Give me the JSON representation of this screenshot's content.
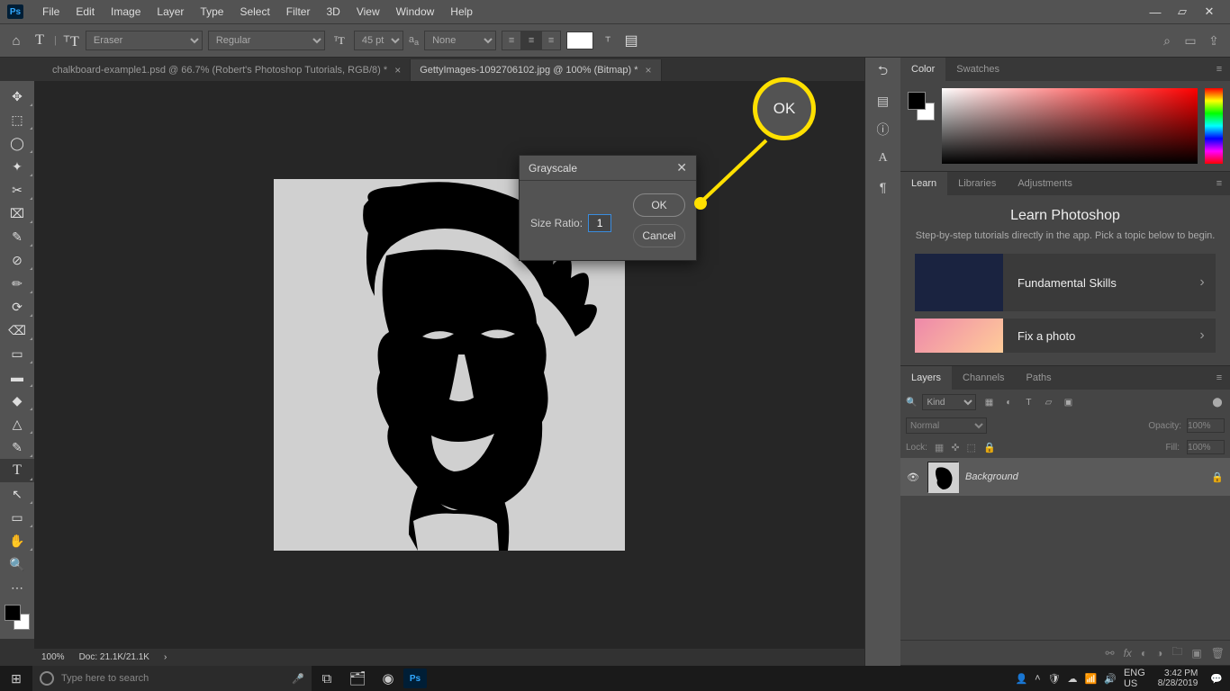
{
  "menubar": {
    "items": [
      "File",
      "Edit",
      "Image",
      "Layer",
      "Type",
      "Select",
      "Filter",
      "3D",
      "View",
      "Window",
      "Help"
    ]
  },
  "optbar": {
    "tool": "Eraser",
    "weight": "Regular",
    "size": "45 pt",
    "aa": "None"
  },
  "tabs": [
    {
      "label": "chalkboard-example1.psd @ 66.7% (Robert's Photoshop Tutorials, RGB/8) *",
      "active": false
    },
    {
      "label": "GettyImages-1092706102.jpg @ 100% (Bitmap) *",
      "active": true
    }
  ],
  "tools": [
    "↔",
    "⬚",
    "◯",
    "✦",
    "✂",
    "⌧",
    "✎",
    "⊘",
    "✏",
    "⟳",
    "⌫",
    "▭",
    "▬",
    "◆",
    "△",
    "✎",
    "◯",
    "T",
    "↖",
    "▭",
    "✋",
    "🔍"
  ],
  "status": {
    "zoom": "100%",
    "doc": "Doc: 21.1K/21.1K"
  },
  "colorPanel": {
    "tabs": [
      "Color",
      "Swatches"
    ]
  },
  "learnPanel": {
    "tabs": [
      "Learn",
      "Libraries",
      "Adjustments"
    ],
    "title": "Learn Photoshop",
    "sub": "Step-by-step tutorials directly in the app. Pick a topic below to begin.",
    "items": [
      {
        "label": "Fundamental Skills"
      },
      {
        "label": "Fix a photo"
      }
    ]
  },
  "layersPanel": {
    "tabs": [
      "Layers",
      "Channels",
      "Paths"
    ],
    "kind": "Kind",
    "blend": "Normal",
    "opacityLabel": "Opacity:",
    "opacity": "100%",
    "lockLabel": "Lock:",
    "fillLabel": "Fill:",
    "fill": "100%",
    "layer": "Background"
  },
  "dialog": {
    "title": "Grayscale",
    "label": "Size Ratio:",
    "value": "1",
    "ok": "OK",
    "cancel": "Cancel"
  },
  "callout": {
    "text": "OK"
  },
  "taskbar": {
    "search": "Type here to search",
    "lang": "ENG",
    "region": "US",
    "time": "3:42 PM",
    "date": "8/28/2019"
  }
}
